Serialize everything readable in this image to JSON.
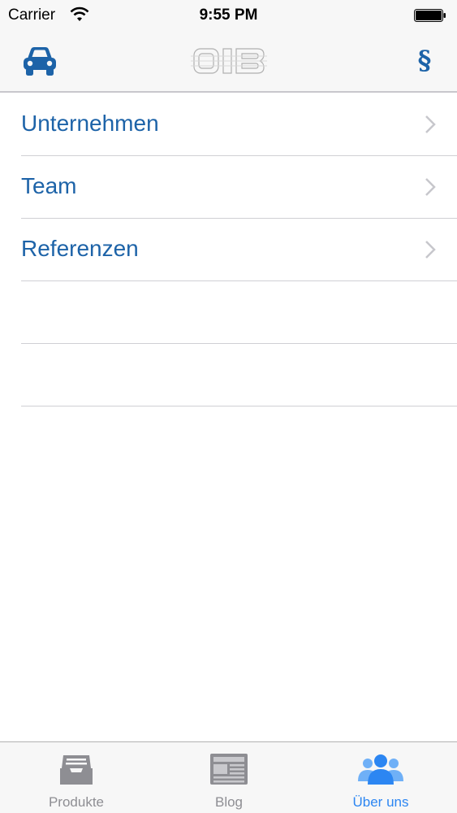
{
  "status_bar": {
    "carrier": "Carrier",
    "time": "9:55 PM"
  },
  "nav_bar": {
    "left_icon": "car-icon",
    "center_logo": "OIB",
    "right_icon_symbol": "§"
  },
  "list": {
    "items": [
      {
        "label": "Unternehmen"
      },
      {
        "label": "Team"
      },
      {
        "label": "Referenzen"
      }
    ]
  },
  "tab_bar": {
    "tabs": [
      {
        "label": "Produkte",
        "icon": "inbox-tray-icon",
        "active": false
      },
      {
        "label": "Blog",
        "icon": "newspaper-icon",
        "active": false
      },
      {
        "label": "Über uns",
        "icon": "people-group-icon",
        "active": true
      }
    ]
  },
  "colors": {
    "accent": "#1d63a8",
    "active_tab": "#2c86f2",
    "inactive_tab": "#8e8e93",
    "separator": "#d0d0d4"
  }
}
